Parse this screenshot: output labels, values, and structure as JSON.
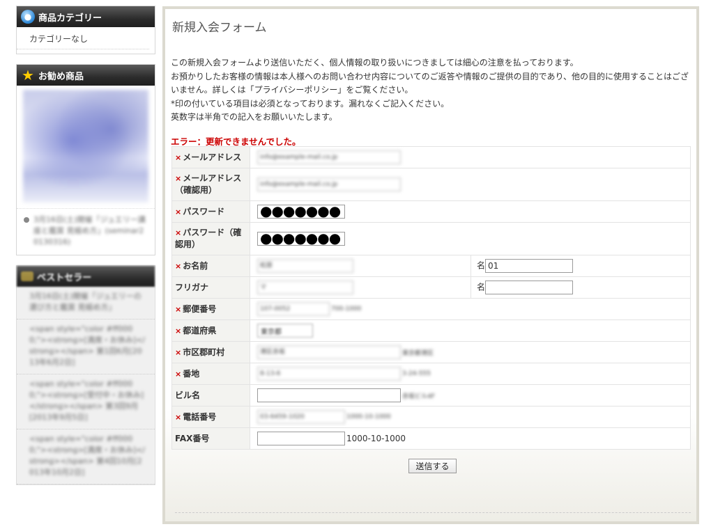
{
  "sidebar": {
    "category": {
      "title": "商品カテゴリー",
      "empty": "カテゴリーなし"
    },
    "recommend": {
      "title": "お勧め商品",
      "item_text": "3月16日(土)開催「ジュエリー講座と鑑賞 見極め方」(seminar20130316)"
    },
    "bestseller": {
      "title": "ベストセラー",
      "items": [
        "3月16日(土)開催「ジュエリーの選び方と鑑賞 見極め方」",
        "<span style=\"color #ff0000;\"><strong>[満席・お休み]</strong></span> 第1回6月[2013年6月2日]",
        "<span style=\"color #ff0000;\"><strong>[受付中・お休み]</strong></span> 第3回9月[2013年9月5日]",
        "<span style=\"color #ff0000;\"><strong>[満席・お休み]</strong></span> 第4回10月[2013年10月2日]"
      ]
    }
  },
  "main": {
    "title": "新規入会フォーム",
    "intro": [
      "この新規入会フォームより送信いただく、個人情報の取り扱いにつきましては細心の注意を払っております。",
      "お預かりしたお客様の情報は本人様へのお問い合わせ内容についてのご返答や情報のご提供の目的であり、他の目的に使用することはございません。詳しくは「プライバシーポリシー」をご覧ください。",
      "*印の付いている項目は必須となっております。漏れなくご記入ください。",
      "英数字は半角での記入をお願いいたします。"
    ],
    "error": "エラー：更新できませんでした。",
    "required_mark": "×",
    "fields": {
      "email": {
        "label": "メールアドレス",
        "value": "info@example-mail.co.jp"
      },
      "email_confirm": {
        "label": "メールアドレス（確認用）",
        "value": "info@example-mail.co.jp"
      },
      "password": {
        "label": "パスワード",
        "value": "●●●●●●●"
      },
      "password_confirm": {
        "label": "パスワード（確認用）",
        "value": "●●●●●●●"
      },
      "name": {
        "label": "お名前",
        "last_value": "松原",
        "first_label": "名",
        "first_value": "01"
      },
      "kana": {
        "label": "フリガナ",
        "last_value": "マ",
        "first_label": "名",
        "first_value": ""
      },
      "zip": {
        "label": "郵便番号",
        "value": "107-0052",
        "note": "700-1000"
      },
      "pref": {
        "label": "都道府県",
        "value": "東京都"
      },
      "city": {
        "label": "市区郡町村",
        "value": "港区赤坂",
        "note": "東京都港区"
      },
      "address": {
        "label": "番地",
        "value": "8-13-6",
        "note": "3-24-555"
      },
      "building": {
        "label": "ビル名",
        "value": "",
        "note": "赤坂ビル4F"
      },
      "tel": {
        "label": "電話番号",
        "value": "03-6459-1020",
        "note": "1000-10-1000"
      },
      "fax": {
        "label": "FAX番号",
        "value": "",
        "note": "1000-10-1000"
      }
    },
    "submit": "送信する"
  }
}
